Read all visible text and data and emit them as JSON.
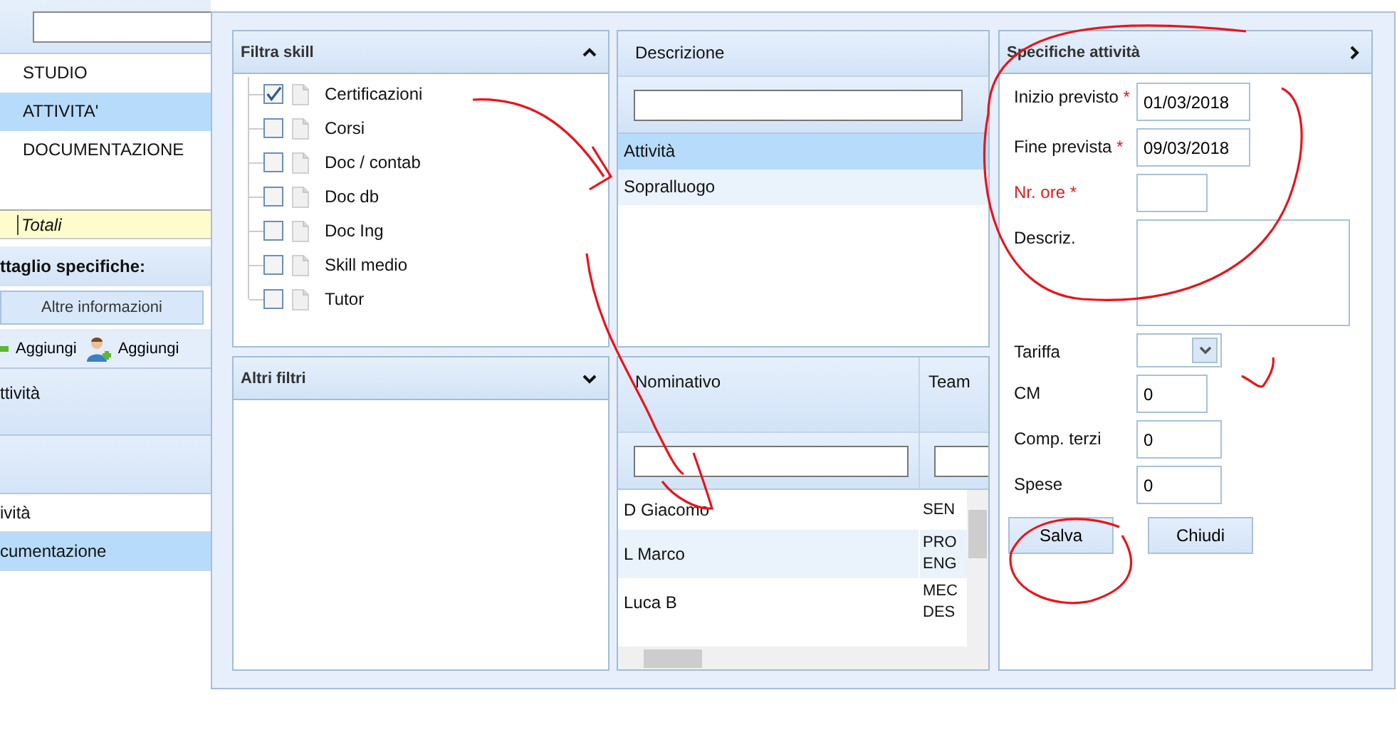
{
  "background": {
    "menu_items": [
      {
        "label": "STUDIO",
        "selected": false
      },
      {
        "label": "ATTIVITA'",
        "selected": true
      },
      {
        "label": "DOCUMENTAZIONE",
        "selected": false
      }
    ],
    "totals_label": "Totali",
    "section_title": "ttaglio specifiche:",
    "info_button": "Altre informazioni",
    "toolbar": [
      {
        "label": "Aggiungi",
        "kind": "add"
      },
      {
        "label": "Aggiungi",
        "kind": "user-add"
      }
    ],
    "panel_header": "ttività",
    "list_items": [
      {
        "label": "ività",
        "selected": false
      },
      {
        "label": "cumentazione",
        "selected": true
      }
    ]
  },
  "dialog": {
    "skill_filter": {
      "title": "Filtra skill",
      "expanded": true,
      "skills": [
        {
          "label": "Certificazioni",
          "checked": true
        },
        {
          "label": "Corsi",
          "checked": false
        },
        {
          "label": "Doc / contab",
          "checked": false
        },
        {
          "label": "Doc db",
          "checked": false
        },
        {
          "label": "Doc Ing",
          "checked": false
        },
        {
          "label": "Skill medio",
          "checked": false
        },
        {
          "label": "Tutor",
          "checked": false
        }
      ]
    },
    "other_filters": {
      "title": "Altri filtri",
      "expanded": false
    },
    "activities": {
      "column": "Descrizione",
      "rows": [
        {
          "label": "Attività",
          "selected": true
        },
        {
          "label": "Sopralluogo",
          "selected": false
        }
      ]
    },
    "people": {
      "columns": [
        "Nominativo",
        "Team"
      ],
      "rows": [
        {
          "name": "D Giacomo",
          "team": "SEN"
        },
        {
          "name": "L Marco",
          "team": "PRO ENG"
        },
        {
          "name": "Luca B",
          "team": "MEC DES"
        }
      ]
    },
    "details": {
      "title": "Specifiche attività",
      "fields": [
        {
          "label": "Inizio previsto",
          "kind": "date",
          "required_mark": "*",
          "invalid": false,
          "value": "01/03/2018"
        },
        {
          "label": "Fine prevista",
          "kind": "date",
          "required_mark": "*",
          "invalid": false,
          "value": "09/03/2018"
        },
        {
          "label": "Nr. ore",
          "kind": "short",
          "required_mark": "*",
          "invalid": true
        },
        {
          "label": "Descriz.",
          "kind": "textarea",
          "invalid": false
        },
        {
          "label": "Tariffa",
          "kind": "select",
          "invalid": false
        },
        {
          "label": "CM",
          "kind": "short",
          "invalid": false,
          "value": "0"
        },
        {
          "label": "Comp. terzi",
          "kind": "number",
          "invalid": false,
          "value": "0"
        },
        {
          "label": "Spese",
          "kind": "number",
          "invalid": false,
          "value": "0"
        }
      ],
      "buttons": [
        "Salva",
        "Chiudi"
      ]
    }
  }
}
